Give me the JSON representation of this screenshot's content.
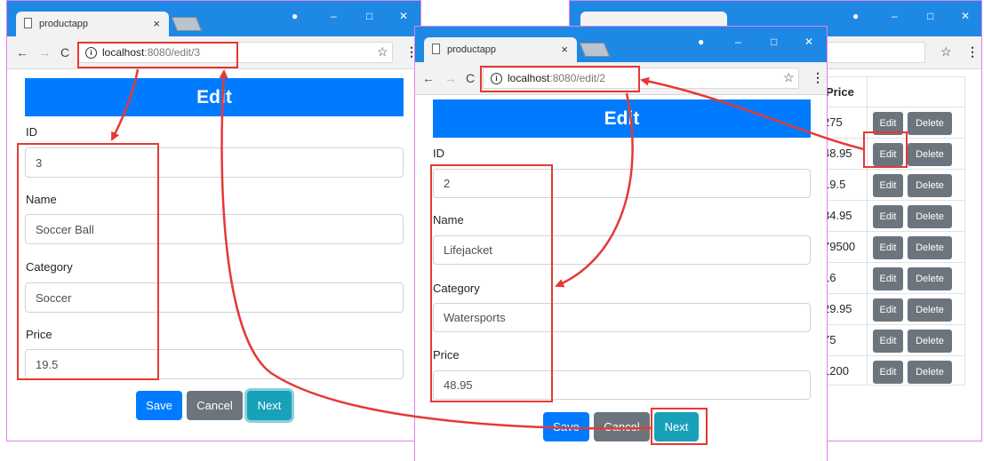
{
  "browser": {
    "tab_title": "productapp",
    "tab_close": "×",
    "back": "←",
    "forward": "→",
    "reload": "C",
    "info": "i",
    "star": "☆",
    "menu": "⋮",
    "minimize": "–",
    "maximize": "□",
    "close": "✕",
    "profile": "●"
  },
  "window_left": {
    "url_host": "localhost",
    "url_path": ":8080/edit/3",
    "heading": "Edit",
    "fields": [
      {
        "label": "ID",
        "value": "3"
      },
      {
        "label": "Name",
        "value": "Soccer Ball"
      },
      {
        "label": "Category",
        "value": "Soccer"
      },
      {
        "label": "Price",
        "value": "19.5"
      }
    ],
    "buttons": {
      "save": "Save",
      "cancel": "Cancel",
      "next": "Next"
    }
  },
  "window_middle": {
    "url_host": "localhost",
    "url_path": ":8080/edit/2",
    "heading": "Edit",
    "fields": [
      {
        "label": "ID",
        "value": "2"
      },
      {
        "label": "Name",
        "value": "Lifejacket"
      },
      {
        "label": "Category",
        "value": "Watersports"
      },
      {
        "label": "Price",
        "value": "48.95"
      }
    ],
    "buttons": {
      "save": "Save",
      "cancel": "Cancel",
      "next": "Next"
    }
  },
  "window_right": {
    "column_header": "Price",
    "edit_label": "Edit",
    "delete_label": "Delete",
    "prices": [
      "275",
      "48.95",
      "19.5",
      "34.95",
      "79500",
      "16",
      "29.95",
      "75",
      "1200"
    ]
  },
  "colors": {
    "primary": "#007bff",
    "secondary": "#6c757d",
    "info": "#17a2b8",
    "annotation": "#e53935",
    "titlebar": "#1e88e5"
  }
}
